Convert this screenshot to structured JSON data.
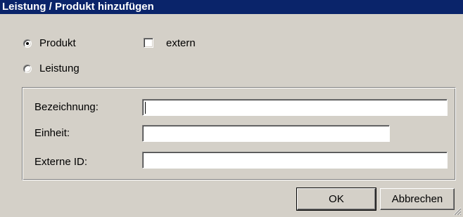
{
  "window": {
    "title": "Leistung / Produkt hinzufügen"
  },
  "type_options": [
    {
      "label": "Produkt",
      "selected": true
    },
    {
      "label": "Leistung",
      "selected": false
    }
  ],
  "extern": {
    "label": "extern",
    "checked": false
  },
  "fields": {
    "bezeichnung": {
      "label": "Bezeichnung:",
      "value": ""
    },
    "einheit": {
      "label": "Einheit:",
      "value": ""
    },
    "externe_id": {
      "label": "Externe ID:",
      "value": ""
    }
  },
  "buttons": {
    "ok": "OK",
    "cancel": "Abbrechen"
  },
  "icons": {
    "radio_selected": "radio-dot-icon",
    "resize": "resize-grip-icon"
  },
  "colors": {
    "titlebar": "#0a246a",
    "dialog_bg": "#d4d0c8"
  }
}
